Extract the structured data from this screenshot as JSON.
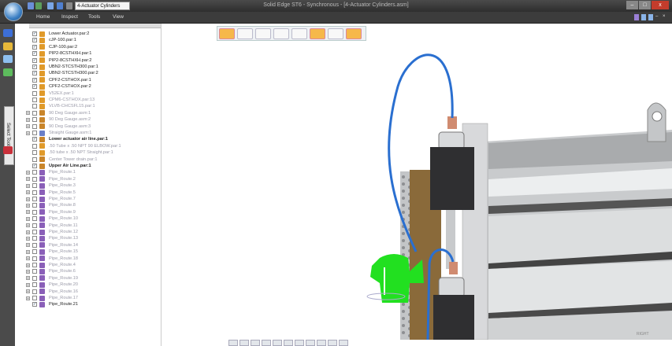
{
  "window": {
    "title": "Solid Edge ST6 - Synchronous - [4-Actuator Cylinders.asm]",
    "document_selector": "4-Actuator Cylinders",
    "controls": [
      "–",
      "□",
      "x"
    ]
  },
  "ribbon": {
    "tabs": [
      "Home",
      "Inspect",
      "Tools",
      "View"
    ]
  },
  "left_strip": {
    "select_tools_label": "Select Tools"
  },
  "tree": {
    "items": [
      {
        "label": "Lower Actuator.par:2",
        "checked": true,
        "state": "normal",
        "icon": "part",
        "expand": false
      },
      {
        "label": "cJP-100.par:1",
        "checked": true,
        "state": "normal",
        "icon": "part",
        "expand": false
      },
      {
        "label": "CJP-100.par:2",
        "checked": true,
        "state": "selected",
        "icon": "part",
        "expand": false
      },
      {
        "label": "PIP2-8CSTHXH.par:1",
        "checked": true,
        "state": "normal",
        "icon": "part",
        "expand": false
      },
      {
        "label": "PIP2-8CSTHXH.par:2",
        "checked": true,
        "state": "normal",
        "icon": "part",
        "expand": false
      },
      {
        "label": "UBN2-STCSTH300.par:1",
        "checked": true,
        "state": "normal",
        "icon": "part",
        "expand": false
      },
      {
        "label": "UBN2-STCSTH300.par:2",
        "checked": true,
        "state": "normal",
        "icon": "part",
        "expand": false
      },
      {
        "label": "CPF2-CSTHOX.par:1",
        "checked": true,
        "state": "selected",
        "icon": "part",
        "expand": false
      },
      {
        "label": "CPF2-CSTHOX.par:2",
        "checked": true,
        "state": "normal",
        "icon": "part",
        "expand": false
      },
      {
        "label": "V52EX.par:1",
        "checked": false,
        "state": "faded",
        "icon": "part",
        "expand": false
      },
      {
        "label": "CPM6-CSTHOX.par:13",
        "checked": false,
        "state": "faded",
        "icon": "part",
        "expand": false
      },
      {
        "label": "VLVB-CHCSFL15.par:1",
        "checked": false,
        "state": "faded",
        "icon": "part",
        "expand": false
      },
      {
        "label": "90 Deg Gauge.asm:1",
        "checked": false,
        "state": "faded",
        "icon": "assembly",
        "expand": true
      },
      {
        "label": "90 Deg Gauge.asm:2",
        "checked": false,
        "state": "faded",
        "icon": "assembly",
        "expand": true
      },
      {
        "label": "90 Deg Gauge.asm:3",
        "checked": false,
        "state": "faded",
        "icon": "assembly",
        "expand": true
      },
      {
        "label": "Straight Gauge.asm:1",
        "checked": false,
        "state": "faded",
        "icon": "assembly-blue",
        "expand": true
      },
      {
        "label": "Lower actuator air line.par:1",
        "checked": true,
        "state": "bold",
        "icon": "tube",
        "expand": false
      },
      {
        "label": ".50 Tube x .50 NPT 90 ELBOW.par:1",
        "checked": false,
        "state": "faded",
        "icon": "part",
        "expand": false
      },
      {
        "label": ".50 tube x .50 NPT Straight.par:1",
        "checked": false,
        "state": "faded",
        "icon": "part",
        "expand": false
      },
      {
        "label": "Center Tower drain.par:1",
        "checked": false,
        "state": "faded",
        "icon": "tube",
        "expand": false
      },
      {
        "label": "Upper Air Line.par:1",
        "checked": true,
        "state": "bold",
        "icon": "tube",
        "expand": false
      },
      {
        "label": "Pipe_Route.1",
        "checked": false,
        "state": "faded",
        "icon": "pipe",
        "expand": true
      },
      {
        "label": "Pipe_Route.2",
        "checked": false,
        "state": "faded",
        "icon": "pipe",
        "expand": true
      },
      {
        "label": "Pipe_Route.3",
        "checked": false,
        "state": "faded",
        "icon": "pipe",
        "expand": true
      },
      {
        "label": "Pipe_Route.5",
        "checked": false,
        "state": "faded",
        "icon": "pipe",
        "expand": true
      },
      {
        "label": "Pipe_Route.7",
        "checked": false,
        "state": "faded",
        "icon": "pipe",
        "expand": true
      },
      {
        "label": "Pipe_Route.8",
        "checked": false,
        "state": "faded",
        "icon": "pipe",
        "expand": true
      },
      {
        "label": "Pipe_Route.9",
        "checked": false,
        "state": "faded",
        "icon": "pipe",
        "expand": true
      },
      {
        "label": "Pipe_Route.10",
        "checked": false,
        "state": "faded",
        "icon": "pipe",
        "expand": true
      },
      {
        "label": "Pipe_Route.11",
        "checked": false,
        "state": "faded",
        "icon": "pipe",
        "expand": true
      },
      {
        "label": "Pipe_Route.12",
        "checked": false,
        "state": "faded",
        "icon": "pipe",
        "expand": true
      },
      {
        "label": "Pipe_Route.13",
        "checked": false,
        "state": "faded",
        "icon": "pipe",
        "expand": true
      },
      {
        "label": "Pipe_Route.14",
        "checked": false,
        "state": "faded",
        "icon": "pipe",
        "expand": true
      },
      {
        "label": "Pipe_Route.15",
        "checked": false,
        "state": "faded",
        "icon": "pipe",
        "expand": true
      },
      {
        "label": "Pipe_Route.18",
        "checked": false,
        "state": "faded",
        "icon": "pipe",
        "expand": true
      },
      {
        "label": "Pipe_Route.4",
        "checked": false,
        "state": "faded",
        "icon": "pipe",
        "expand": true
      },
      {
        "label": "Pipe_Route.6",
        "checked": false,
        "state": "faded",
        "icon": "pipe",
        "expand": true
      },
      {
        "label": "Pipe_Route.19",
        "checked": false,
        "state": "faded",
        "icon": "pipe",
        "expand": true
      },
      {
        "label": "Pipe_Route.20",
        "checked": false,
        "state": "faded",
        "icon": "pipe",
        "expand": true
      },
      {
        "label": "Pipe_Route.16",
        "checked": false,
        "state": "faded",
        "icon": "pipe",
        "expand": true
      },
      {
        "label": "Pipe_Route.17",
        "checked": false,
        "state": "faded",
        "icon": "pipe",
        "expand": true
      },
      {
        "label": "Pipe_Route.21",
        "checked": true,
        "state": "normal",
        "icon": "pipe",
        "expand": false
      }
    ]
  },
  "view_toolbar": {
    "buttons": [
      "select-view-icon",
      "window-icon",
      "show-parts-icon",
      "hide-parts-icon",
      "panel-icon",
      "style-dropdown-icon",
      "display-dropdown-icon",
      "axis-dropdown-icon"
    ]
  },
  "viewport": {
    "view_cube_label": "RIGHT"
  },
  "colors": {
    "tube": "#2a6fd0",
    "highlight": "#22e020",
    "selection": "#2b63c8",
    "toolbar_active": "#f6b84a"
  }
}
